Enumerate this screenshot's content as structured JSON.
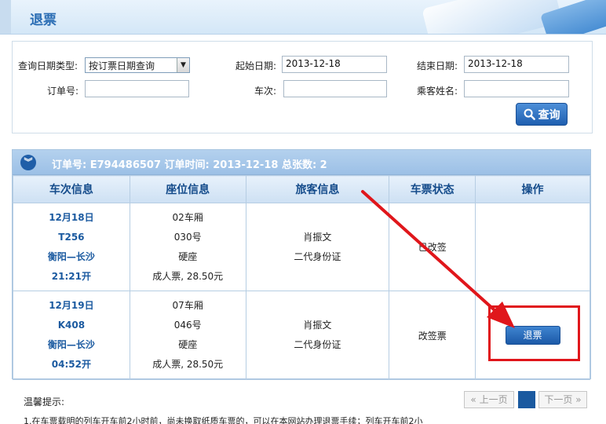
{
  "header": {
    "title": "退票"
  },
  "search": {
    "date_type_label": "查询日期类型:",
    "date_type_value": "按订票日期查询",
    "start_label": "起始日期:",
    "start_value": "2013-12-18",
    "end_label": "结束日期:",
    "end_value": "2013-12-18",
    "order_no_label": "订单号:",
    "order_no_value": "",
    "train_label": "车次:",
    "train_value": "",
    "passenger_label": "乘客姓名:",
    "passenger_value": "",
    "query_button": "查询"
  },
  "order": {
    "header_text": "订单号: E794486507  订单时间:  2013-12-18  总张数: 2",
    "columns": [
      "车次信息",
      "座位信息",
      "旅客信息",
      "车票状态",
      "操作"
    ],
    "rows": [
      {
        "date": "12月18日",
        "train": "T256",
        "route": "衡阳—长沙",
        "time": "21:21开",
        "car": "02车厢",
        "seat": "030号",
        "seat_type": "硬座",
        "fare": "成人票, 28.50元",
        "name": "肖振文",
        "id_type": "二代身份证",
        "status": "已改签",
        "action": ""
      },
      {
        "date": "12月19日",
        "train": "K408",
        "route": "衡阳—长沙",
        "time": "04:52开",
        "car": "07车厢",
        "seat": "046号",
        "seat_type": "硬座",
        "fare": "成人票, 28.50元",
        "name": "肖振文",
        "id_type": "二代身份证",
        "status": "改签票",
        "action": "退票"
      }
    ]
  },
  "tips": {
    "title": "温馨提示:",
    "line1": "1.在车票载明的列车开车前2小时前，尚未换取纸质车票的，可以在本网站办理退票手续；列车开车前2小"
  },
  "pager": {
    "prev": "« 上一页",
    "next": "下一页 »"
  },
  "colors": {
    "accent": "#1b5aa0",
    "highlight": "#e0161b"
  }
}
